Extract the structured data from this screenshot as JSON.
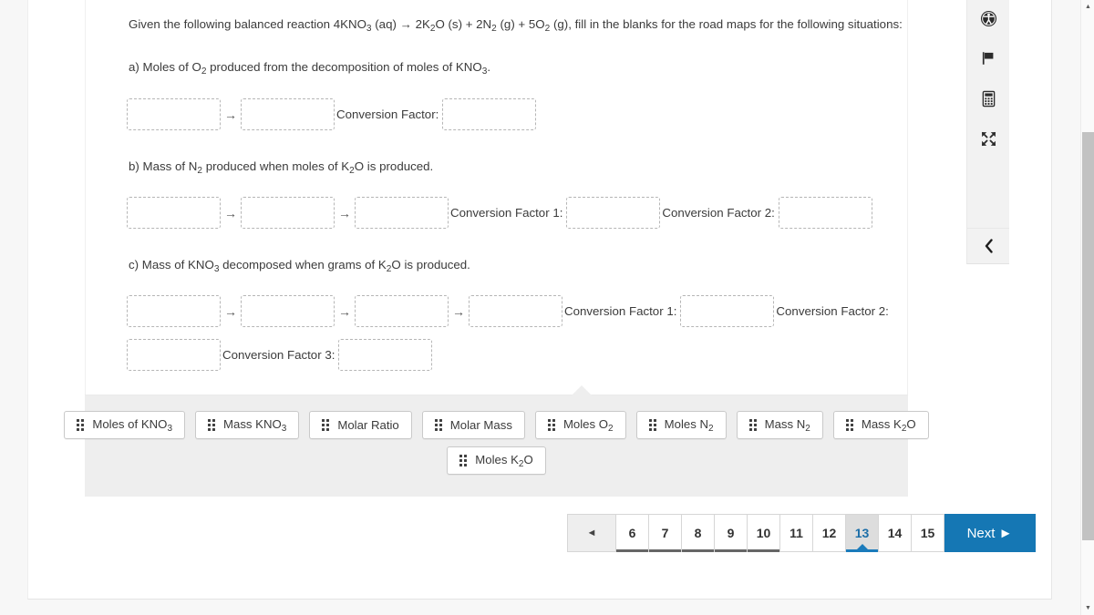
{
  "question": {
    "prompt_parts": [
      "Given the following balanced reaction 4KNO",
      "3",
      " (aq) → 2K",
      "2",
      "O (s) + 2N",
      "2",
      " (g) + 5O",
      "2",
      " (g), fill in the blanks for the road maps for the following situations:"
    ],
    "prompt_plain": "Given the following balanced reaction 4KNO3 (aq) → 2K2O (s) + 2N2 (g) + 5O2 (g), fill in the blanks for the road maps for the following situations:",
    "part_a": "a) Moles of O2 produced from the decomposition of moles of KNO3.",
    "part_b": "b) Mass of N2 produced when moles of K2O is produced.",
    "part_c": "c) Mass of KNO3 decomposed when grams of K2O is produced."
  },
  "roadmaps": {
    "a": {
      "blank_count": 2,
      "labels": [
        "Conversion Factor:"
      ],
      "conversion_blank_count": 1
    },
    "b": {
      "blank_count": 3,
      "labels": [
        "Conversion Factor 1:",
        "Conversion Factor 2:"
      ],
      "conversion_blank_count": 2
    },
    "c": {
      "blank_count": 4,
      "labels": [
        "Conversion Factor 1:",
        "Conversion Factor 2:",
        "Conversion Factor 3:"
      ],
      "conversion_blank_count": 3
    },
    "arrow_glyph": "→"
  },
  "token_bank": {
    "rows": [
      [
        {
          "label": "Moles of KNO3",
          "base": "Moles of KNO",
          "sub": "3"
        },
        {
          "label": "Mass KNO3",
          "base": "Mass KNO",
          "sub": "3"
        },
        {
          "label": "Molar Ratio",
          "base": "Molar Ratio",
          "sub": ""
        },
        {
          "label": "Molar Mass",
          "base": "Molar Mass",
          "sub": ""
        },
        {
          "label": "Moles O2",
          "base": "Moles O",
          "sub": "2"
        },
        {
          "label": "Moles N2",
          "base": "Moles N",
          "sub": "2"
        },
        {
          "label": "Mass N2",
          "base": "Mass N",
          "sub": "2"
        },
        {
          "label": "Mass K2O",
          "base": "Mass K",
          "sub": "2",
          "tail": "O"
        }
      ],
      [
        {
          "label": "Moles K2O",
          "base": "Moles K",
          "sub": "2",
          "tail": "O"
        }
      ]
    ],
    "grip_icon": "drag-handle-icon"
  },
  "pagination": {
    "prev_label": "◄",
    "pages": [
      {
        "number": "6",
        "state": "visited"
      },
      {
        "number": "7",
        "state": "visited"
      },
      {
        "number": "8",
        "state": "visited"
      },
      {
        "number": "9",
        "state": "visited"
      },
      {
        "number": "10",
        "state": "visited"
      },
      {
        "number": "11",
        "state": "normal"
      },
      {
        "number": "12",
        "state": "normal"
      },
      {
        "number": "13",
        "state": "current"
      },
      {
        "number": "14",
        "state": "normal"
      },
      {
        "number": "15",
        "state": "normal"
      }
    ],
    "next_label": "Next ►",
    "accent_color": "#1577b4"
  },
  "tool_rail": {
    "buttons": [
      {
        "name": "accessibility-icon",
        "glyph": "♿"
      },
      {
        "name": "flag-icon",
        "glyph": "⚑"
      },
      {
        "name": "calculator-icon",
        "glyph": "▦"
      },
      {
        "name": "fullscreen-icon",
        "glyph": "⤢"
      }
    ],
    "collapse_glyph": "‹"
  },
  "scrollbar": {
    "up_glyph": "▲",
    "down_glyph": "▼"
  }
}
